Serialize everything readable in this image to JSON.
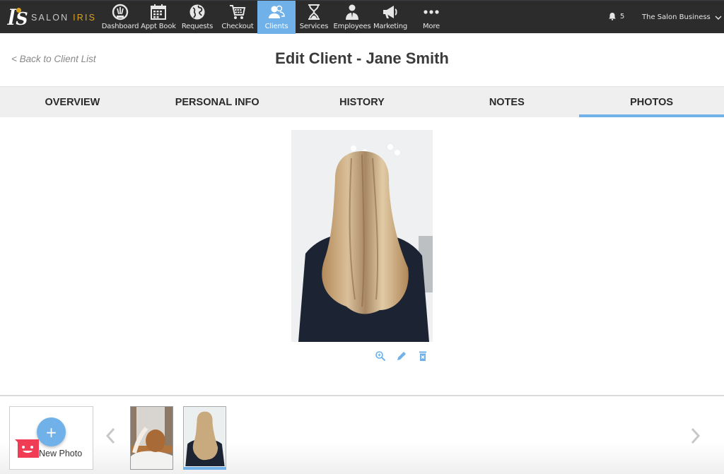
{
  "app": {
    "brand_left": "SALON",
    "brand_right": "IRIS",
    "accent_color": "#6fb1e8",
    "brand_gold": "#d9a321"
  },
  "nav": {
    "items": [
      {
        "label": "Dashboard",
        "icon": "dashboard-gauge-icon"
      },
      {
        "label": "Appt Book",
        "icon": "calendar-icon"
      },
      {
        "label": "Requests",
        "icon": "globe-icon"
      },
      {
        "label": "Checkout",
        "icon": "cart-icon"
      },
      {
        "label": "Clients",
        "icon": "clients-icon",
        "active": true
      },
      {
        "label": "Services",
        "icon": "hourglass-icon"
      },
      {
        "label": "Employees",
        "icon": "employee-icon"
      },
      {
        "label": "Marketing",
        "icon": "megaphone-icon"
      },
      {
        "label": "More",
        "icon": "more-dots-icon"
      }
    ],
    "notifications_count": "5",
    "account_name": "The Salon Business"
  },
  "header": {
    "back_link": "< Back to Client List",
    "title": "Edit Client - Jane Smith"
  },
  "tabs": [
    {
      "label": "OVERVIEW"
    },
    {
      "label": "PERSONAL INFO"
    },
    {
      "label": "HISTORY"
    },
    {
      "label": "NOTES"
    },
    {
      "label": "PHOTOS",
      "active": true
    }
  ],
  "photo": {
    "description": "Back view of client with long blonde balayage hair",
    "actions": [
      "zoom-in",
      "edit",
      "delete"
    ]
  },
  "gallery": {
    "new_photo_label": "New Photo",
    "new_photo_symbol": "+",
    "thumbnails": [
      {
        "description": "Updo styling in salon"
      },
      {
        "description": "Long blonde balayage hair, back view",
        "selected": true
      }
    ]
  }
}
